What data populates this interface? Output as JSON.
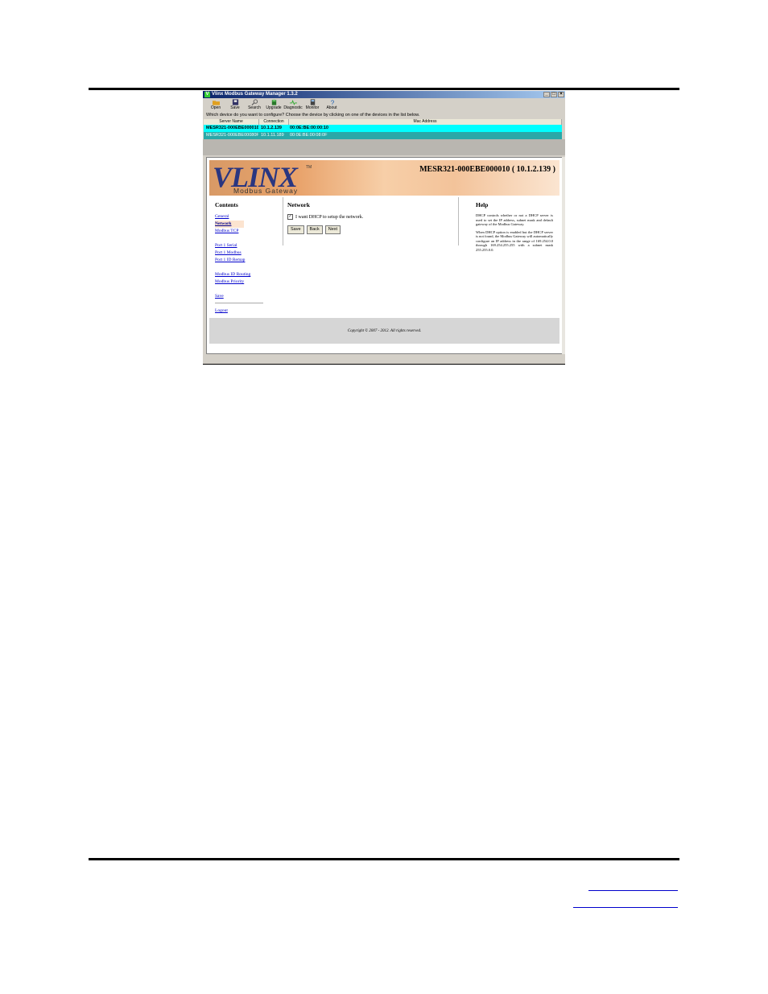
{
  "window": {
    "title": "Vlinx Modbus Gateway Manager 1.3.2"
  },
  "toolbar": [
    {
      "label": "Open",
      "icon": "folder-open-icon",
      "color": "#e0a020"
    },
    {
      "label": "Save",
      "icon": "floppy-icon",
      "color": "#333366"
    },
    {
      "label": "Search",
      "icon": "search-icon",
      "color": "#555555"
    },
    {
      "label": "Upgrade",
      "icon": "upgrade-icon",
      "color": "#2a7a2a"
    },
    {
      "label": "Diagnostic",
      "icon": "diagnostic-icon",
      "color": "#33aa33"
    },
    {
      "label": "Monitor",
      "icon": "monitor-icon",
      "color": "#444444"
    },
    {
      "label": "About",
      "icon": "question-icon",
      "color": "#1a5fb4"
    }
  ],
  "prompt": "Which device do you want to configure? Choose the device by clicking on one of the devices in the list below.",
  "table": {
    "headers": [
      "Server Name",
      "Connection",
      "Mac Address"
    ],
    "rows": [
      [
        "MESR321-000EBE000010",
        "10.1.2.139",
        "00:0E:BE:00:00:10"
      ],
      [
        "MESR321-000EBE00080F",
        "10.1.11.189",
        "00:0E:BE:00:08:0F"
      ]
    ]
  },
  "banner": {
    "logo": "VLINX",
    "trademark": "TM",
    "subtitle": "Modbus Gateway",
    "device": "MESR321-000EBE000010 ( 10.1.2.139 )"
  },
  "contents": {
    "heading": "Contents",
    "items": [
      "General",
      "Network",
      "Modbus TCP",
      "Port 1 Serial",
      "Port 1 Modbus",
      "Port 1 ID Remap",
      "Modbus ID Routing",
      "Modbus Priority",
      "Save",
      "Logout"
    ]
  },
  "network": {
    "heading": "Network",
    "checkbox_label": "I want DHCP to setup the network.",
    "checkbox_mark": "✓",
    "buttons": {
      "save": "Save",
      "back": "Back",
      "next": "Next"
    }
  },
  "help": {
    "heading": "Help",
    "p1": "DHCP controls whether or not a DHCP server is used to set the IP address, subnet mask and default gateway of the Modbus Gateway.",
    "p2": "When DHCP option is enabled but the DHCP server is not found, the Modbus Gateway will automatically configure an IP address in the range of 169.254.0.0 through 169.254.255.255 with a subnet mask 255.255.0.0."
  },
  "footer": {
    "copyright": "Copyright © 2007 - 2012. All rights reserved."
  }
}
